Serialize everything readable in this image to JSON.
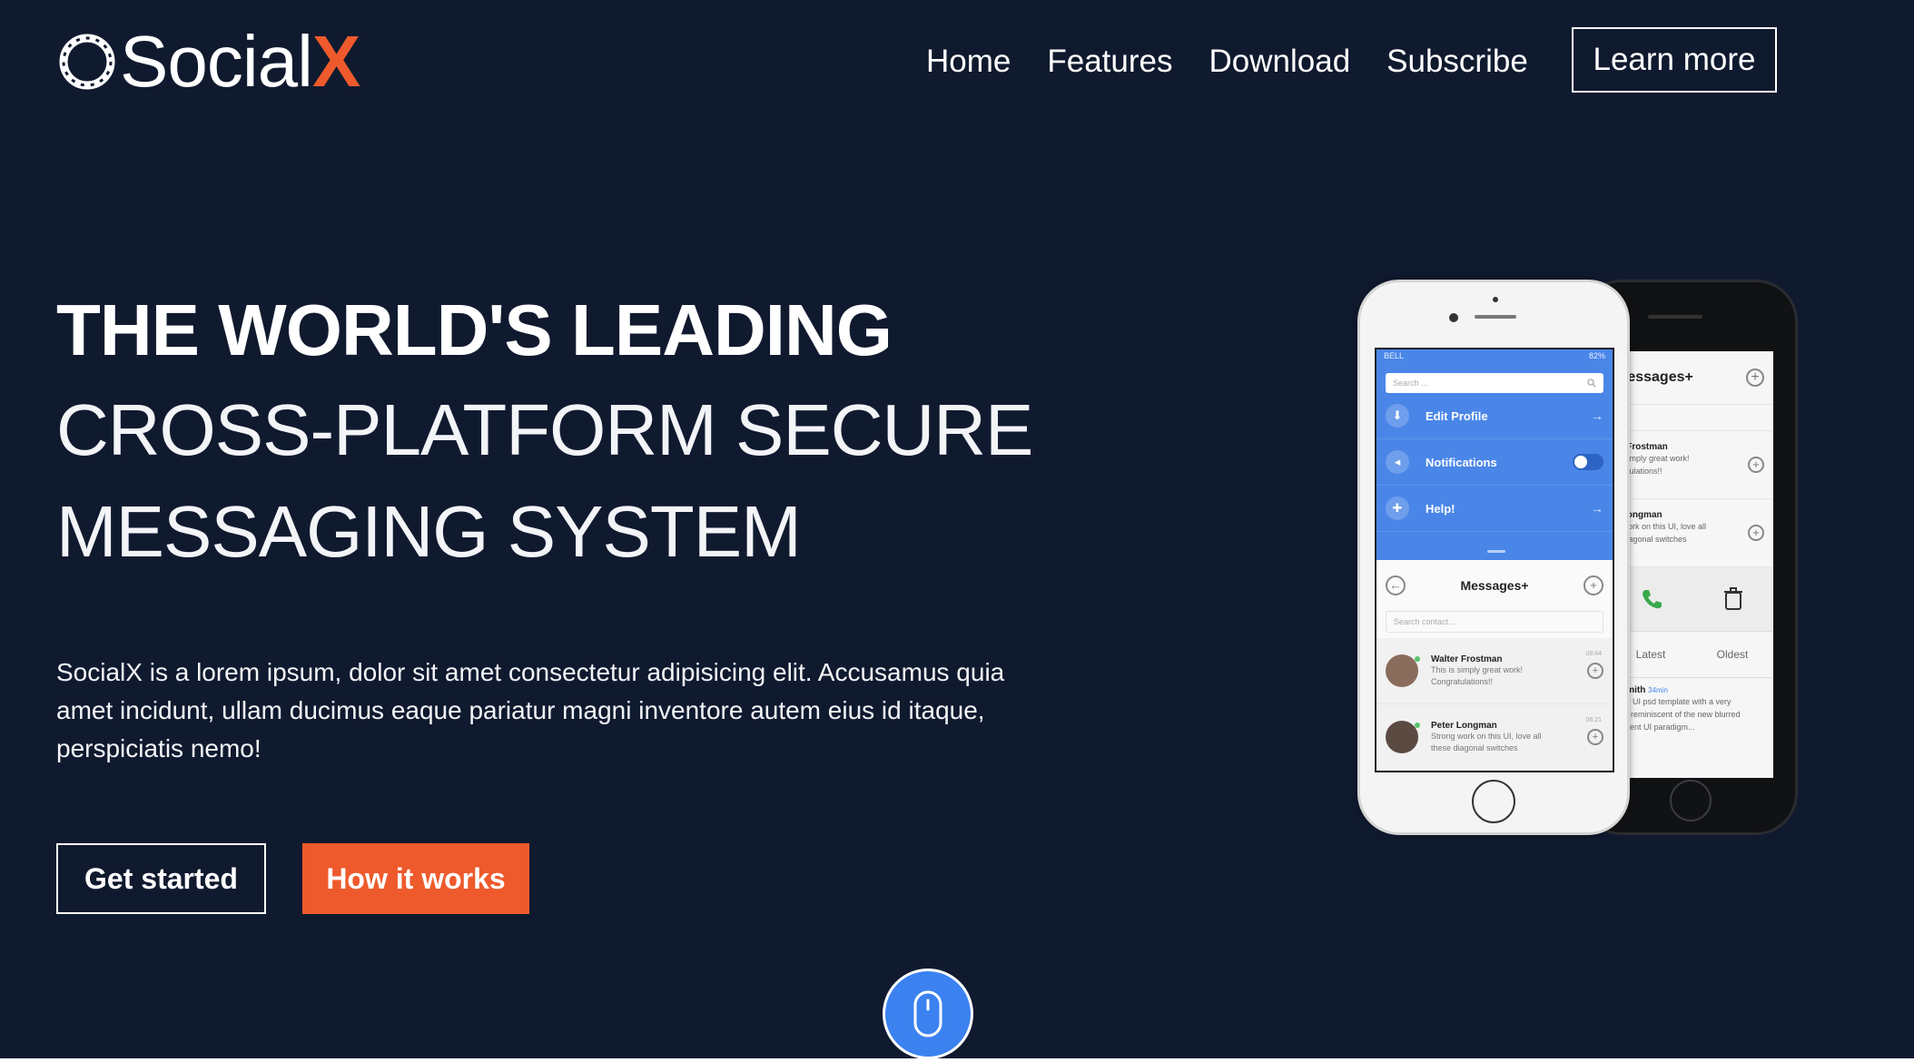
{
  "brand": {
    "name_main": "Social",
    "name_accent": "X"
  },
  "nav": {
    "items": [
      "Home",
      "Features",
      "Download",
      "Subscribe"
    ],
    "cta": "Learn more"
  },
  "hero": {
    "line1": "THE WORLD'S LEADING",
    "line2": "CROSS-PLATFORM SECURE",
    "line3": "MESSAGING SYSTEM",
    "description": "SocialX is a lorem ipsum, dolor sit amet consectetur adipisicing elit. Accusamus quia amet incidunt, ullam ducimus eaque pariatur magni inventore autem eius id itaque, perspiciatis nemo!",
    "primary_button": "Get started",
    "secondary_button": "How it works"
  },
  "phone_front": {
    "status_left": "BELL",
    "status_right": "82%",
    "search_placeholder": "Search ...",
    "menu": [
      {
        "label": "Edit Profile",
        "icon": "download-icon"
      },
      {
        "label": "Notifications",
        "icon": "megaphone-icon"
      },
      {
        "label": "Help!",
        "icon": "lifebuoy-icon"
      }
    ],
    "messages_title": "Messages+",
    "contact_search_placeholder": "Search contact...",
    "contacts": [
      {
        "name": "Walter Frostman",
        "msg1": "This is simply great work!",
        "msg2": "Congratulations!!",
        "time": "08:44"
      },
      {
        "name": "Peter Longman",
        "msg1": "Strong work on this UI, love all",
        "msg2": "these diagonal switches",
        "time": "06:21"
      }
    ]
  },
  "phone_back": {
    "messages_title": "Messages+",
    "rows": [
      {
        "name": "er Frostman",
        "msg1": "is simply great work!",
        "msg2": "gratulations!!"
      },
      {
        "name": "r Longman",
        "msg1": "g work on this UI, love all",
        "msg2": "e diagonal switches"
      }
    ],
    "tabs": [
      "Latest",
      "Oldest"
    ],
    "last_row": {
      "name": "l Smith",
      "time": "34min",
      "msg1": "new UI psd template with a very",
      "msg2": "feel reminiscent of the new blurred",
      "msg3": "slucent UI paradigm..."
    }
  },
  "colors": {
    "background": "#101a2f",
    "accent": "#ee5a2c",
    "scroll_button": "#3b82f0",
    "phone_blue": "#4a86e8"
  },
  "icons": {
    "scroll": "mouse-icon",
    "logo": "logo-ring-icon"
  }
}
